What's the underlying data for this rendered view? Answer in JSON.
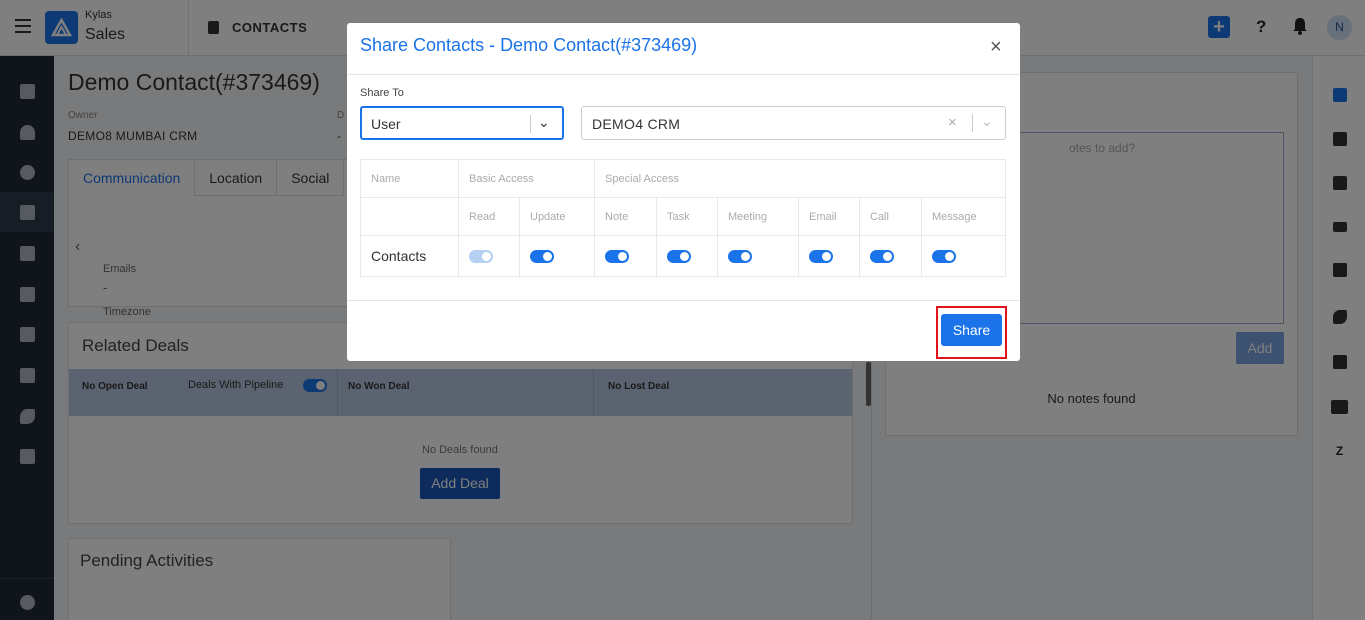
{
  "app": {
    "brand_top": "Kylas",
    "brand_bottom": "Sales",
    "section_title": "CONTACTS",
    "add_icon": "+",
    "help_icon": "?",
    "avatar_initial": "N"
  },
  "colors": {
    "primary": "#1a73e8",
    "sidebar": "#1f2a37",
    "highlight": "#e0121a"
  },
  "left_nav": {
    "items": [
      "dashboard-icon",
      "user-icon",
      "money-bag-icon",
      "contacts-icon",
      "building-icon",
      "clipboard-icon",
      "checkbox-icon",
      "calendar-icon",
      "phone-icon",
      "reports-icon",
      "settings-icon"
    ]
  },
  "right_nav": {
    "items": [
      "note-icon",
      "task-icon",
      "calendar-icon",
      "email-icon",
      "chat-icon",
      "phone-icon",
      "clipboard-icon",
      "folder-icon",
      "zendesk-icon"
    ],
    "z_label": "Z"
  },
  "contact": {
    "title": "Demo Contact(#373469)",
    "owner_label": "Owner",
    "owner_value": "DEMO8 MUMBAI CRM",
    "second_label": "D",
    "second_value": "-",
    "tabs": [
      "Communication",
      "Location",
      "Social"
    ],
    "fields": [
      {
        "label": "Emails",
        "value": "-"
      },
      {
        "label": "Timezone",
        "value": "-"
      }
    ]
  },
  "deals": {
    "title": "Related Deals",
    "col_open": "No Open Deal",
    "pipeline_label": "Deals With Pipeline",
    "col_won": "No Won Deal",
    "col_lost": "No Lost Deal",
    "empty": "No Deals found",
    "add_button": "Add Deal"
  },
  "pending": {
    "title": "Pending Activities"
  },
  "notes": {
    "placeholder": "otes to add?",
    "add_button": "Add",
    "empty": "No notes found"
  },
  "modal": {
    "title": "Share Contacts - Demo Contact(#373469)",
    "close": "×",
    "share_to_label": "Share To",
    "type_value": "User",
    "user_value": "DEMO4 CRM",
    "header_name": "Name",
    "header_basic": "Basic Access",
    "header_special": "Special Access",
    "sub_headers": [
      "Read",
      "Update",
      "Note",
      "Task",
      "Meeting",
      "Email",
      "Call",
      "Message"
    ],
    "row_label": "Contacts",
    "toggles": {
      "read": {
        "on": true,
        "disabled": true
      },
      "update": {
        "on": true,
        "disabled": false
      },
      "note": {
        "on": true,
        "disabled": false
      },
      "task": {
        "on": true,
        "disabled": false
      },
      "meeting": {
        "on": true,
        "disabled": false
      },
      "email": {
        "on": true,
        "disabled": false
      },
      "call": {
        "on": true,
        "disabled": false
      },
      "message": {
        "on": true,
        "disabled": false
      }
    },
    "share_button": "Share"
  }
}
